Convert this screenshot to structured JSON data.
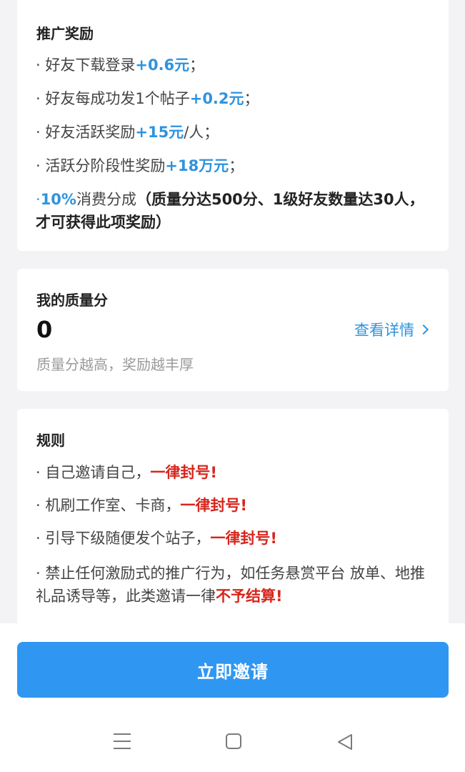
{
  "rewards": {
    "title": "推广奖励",
    "items": [
      {
        "prefix": "· 好友下载登录",
        "highlight": "+0.6元",
        "suffix": "；"
      },
      {
        "prefix": "· 好友每成功发1个帖子",
        "highlight": "+0.2元",
        "suffix": "；"
      },
      {
        "prefix": "· 好友活跃奖励",
        "highlight": "+15元",
        "suffix": "/人；"
      },
      {
        "prefix": "· 活跃分阶段性奖励",
        "highlight": "+18万元",
        "suffix": "；"
      }
    ],
    "commission": {
      "prefix": "·",
      "highlight": "10%",
      "text": "消费分成",
      "condition": "（质量分达500分、1级好友数量达30人，才可获得此项奖励）"
    }
  },
  "quality": {
    "title": "我的质量分",
    "score": "0",
    "details_label": "查看详情",
    "tip": "质量分越高，奖励越丰厚"
  },
  "rules": {
    "title": "规则",
    "items": [
      {
        "prefix": "· 自己邀请自己，",
        "warning": "一律封号!"
      },
      {
        "prefix": "· 机刷工作室、卡商，",
        "warning": "一律封号!"
      },
      {
        "prefix": "· 引导下级随便发个站子，",
        "warning": "一律封号!"
      }
    ],
    "last": {
      "prefix": "· 禁止任何激励式的推广行为，如任务悬赏平台 放单、地推礼品诱导等，此类邀请一律",
      "warning": "不予结算!"
    }
  },
  "invite_button_label": "立即邀请",
  "nav_icons": [
    "menu-icon",
    "home-icon",
    "back-icon"
  ],
  "colors": {
    "accent_blue": "#2f93de",
    "button_blue": "#2f97f2",
    "warning_red": "#d7261d"
  }
}
